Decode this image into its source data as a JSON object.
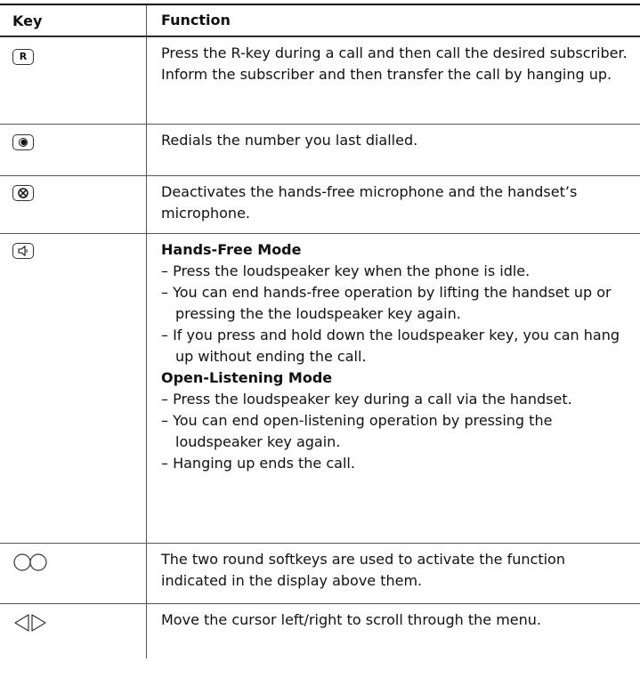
{
  "table": {
    "headers": {
      "key": "Key",
      "function": "Function"
    },
    "rows": [
      {
        "key_icon": "r-key-icon",
        "key_label": "R",
        "paragraphs": [
          "Press the R-key during a call and then call the desired subscriber. Inform the subscriber and then transfer the call by hanging up."
        ]
      },
      {
        "key_icon": "redial-key-icon",
        "paragraphs": [
          "Redials the number you last dialled."
        ]
      },
      {
        "key_icon": "mute-key-icon",
        "paragraphs": [
          "Deactivates the hands-free microphone and the handset’s microphone."
        ]
      },
      {
        "key_icon": "loudspeaker-key-icon",
        "sections": [
          {
            "title": "Hands-Free Mode",
            "bullets": [
              "– Press the loudspeaker key when the phone is idle.",
              "– You can end hands-free operation by lifting the handset up or pressing the the loudspeaker key again.",
              "– If you press and hold down the loudspeaker key, you can hang up without ending the call."
            ]
          },
          {
            "title": "Open-Listening Mode",
            "bullets": [
              "– Press the loudspeaker key during a call via the handset.",
              "– You can end open-listening operation by pressing the loudspeaker key again.",
              "– Hanging up ends the call."
            ]
          }
        ]
      },
      {
        "key_icon": "round-softkeys-icon",
        "paragraphs": [
          "The two round softkeys are used to activate the function indicated in the display above them."
        ]
      },
      {
        "key_icon": "cursor-arrows-icon",
        "paragraphs": [
          "Move the cursor left/right to scroll through the menu."
        ]
      }
    ]
  }
}
